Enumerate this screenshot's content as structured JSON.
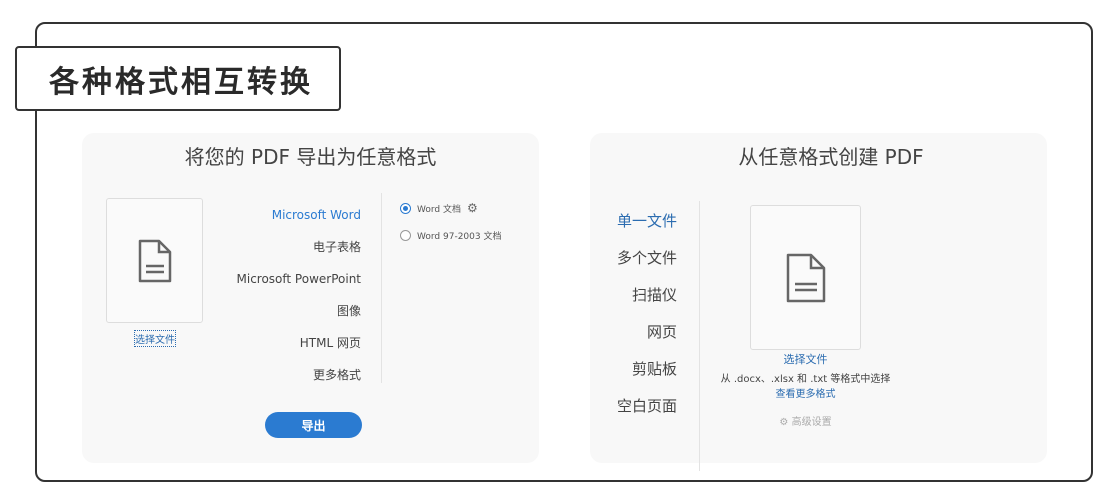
{
  "header": {
    "title": "各种格式相互转换"
  },
  "export": {
    "title": "将您的 PDF 导出为任意格式",
    "select_file": "选择文件",
    "formats": [
      "Microsoft Word",
      "电子表格",
      "Microsoft PowerPoint",
      "图像",
      "HTML 网页",
      "更多格式"
    ],
    "options": [
      "Word 文档",
      "Word 97-2003 文档"
    ],
    "export_button": "导出"
  },
  "create": {
    "title": "从任意格式创建 PDF",
    "menu": [
      "单一文件",
      "多个文件",
      "扫描仪",
      "网页",
      "剪贴板",
      "空白页面"
    ],
    "select_file": "选择文件",
    "hint": "从 .docx、.xlsx 和 .txt 等格式中选择",
    "more_formats": "查看更多格式",
    "advanced": "高级设置"
  },
  "colors": {
    "accent": "#2b7bd1"
  }
}
